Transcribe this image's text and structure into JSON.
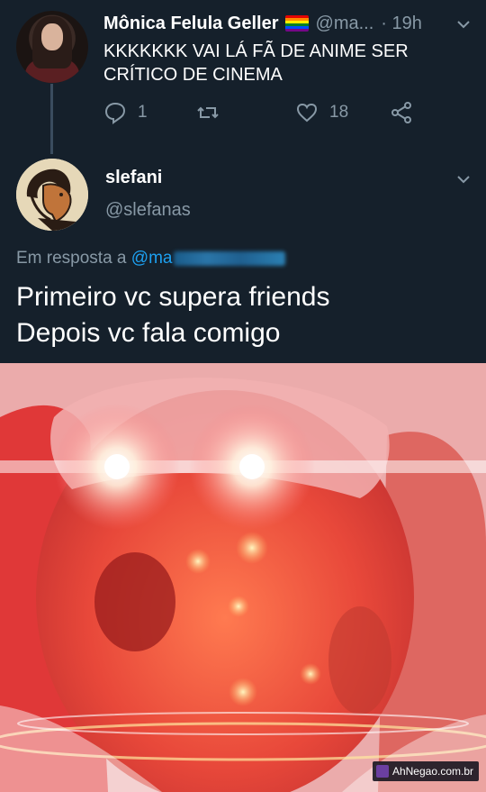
{
  "tweet_original": {
    "display_name": "Mônica Felula Geller",
    "handle": "@ma...",
    "time": "· 19h",
    "text_line1": "KKKKKKK VAI LÁ FÃ DE ANIME SER",
    "text_line2": "CRÍTICO DE CINEMA",
    "reply_count": "1",
    "like_count": "18",
    "icons": [
      "avatar",
      "pride-flag-icon",
      "chevron-down-icon",
      "reply-icon",
      "retweet-icon",
      "like-icon",
      "share-icon"
    ]
  },
  "tweet_reply": {
    "display_name": "slefani",
    "handle": "@slefanas",
    "reply_prefix": "Em resposta a",
    "reply_mention": "@ma",
    "text_line1": "Primeiro vc supera friends",
    "text_line2": "Depois vc fala comigo"
  },
  "meme": {
    "watermark": "AhNegao.com.br"
  },
  "colors": {
    "background": "#15202b",
    "secondary_text": "#8899a6",
    "link": "#1da1f2",
    "thread_line": "#3a4c5e"
  }
}
